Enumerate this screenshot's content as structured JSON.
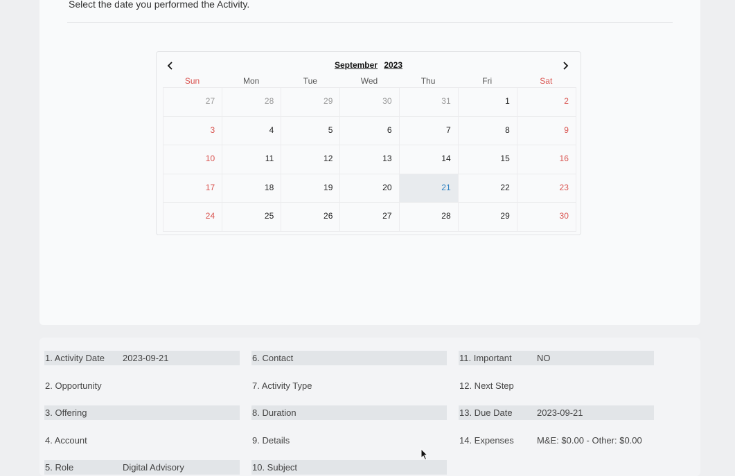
{
  "instruction": "Select the date you performed the Activity.",
  "calendar": {
    "month": "September",
    "year": "2023",
    "prev_icon": "chevron-left-icon",
    "next_icon": "chevron-right-icon",
    "weekdays": [
      "Sun",
      "Mon",
      "Tue",
      "Wed",
      "Thu",
      "Fri",
      "Sat"
    ],
    "weeks": [
      [
        "27",
        "28",
        "29",
        "30",
        "31",
        "1",
        "2"
      ],
      [
        "3",
        "4",
        "5",
        "6",
        "7",
        "8",
        "9"
      ],
      [
        "10",
        "11",
        "12",
        "13",
        "14",
        "15",
        "16"
      ],
      [
        "17",
        "18",
        "19",
        "20",
        "21",
        "22",
        "23"
      ],
      [
        "24",
        "25",
        "26",
        "27",
        "28",
        "29",
        "30"
      ]
    ],
    "selected_day": "21",
    "colors": {
      "weekend": "#d9534f",
      "selected": "#2a7fc1",
      "other_month": "#999999"
    }
  },
  "summary": {
    "fields": [
      {
        "label": "1. Activity Date",
        "value": "2023-09-21"
      },
      {
        "label": "2. Opportunity",
        "value": ""
      },
      {
        "label": "3. Offering",
        "value": ""
      },
      {
        "label": "4. Account",
        "value": ""
      },
      {
        "label": "5. Role",
        "value": "Digital Advisory"
      },
      {
        "label": "6. Contact",
        "value": ""
      },
      {
        "label": "7. Activity Type",
        "value": ""
      },
      {
        "label": "8. Duration",
        "value": ""
      },
      {
        "label": "9. Details",
        "value": ""
      },
      {
        "label": "10. Subject",
        "value": ""
      },
      {
        "label": "11. Important",
        "value": "NO"
      },
      {
        "label": "12. Next Step",
        "value": ""
      },
      {
        "label": "13. Due Date",
        "value": "2023-09-21"
      },
      {
        "label": "14. Expenses",
        "value": "M&E: $0.00 - Other: $0.00"
      }
    ]
  }
}
